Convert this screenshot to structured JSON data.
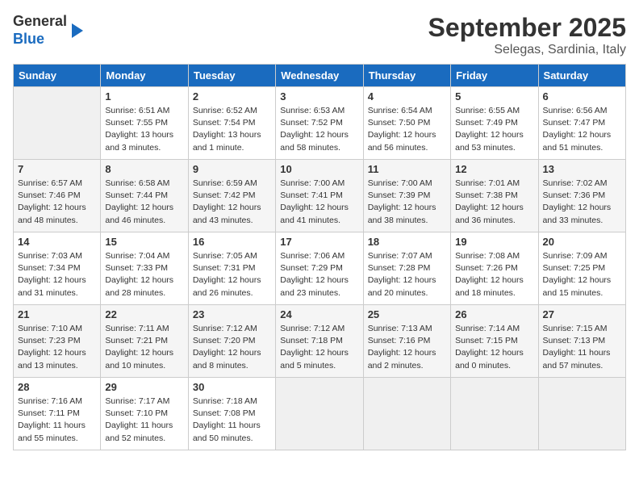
{
  "header": {
    "logo_line1": "General",
    "logo_line2": "Blue",
    "month": "September 2025",
    "location": "Selegas, Sardinia, Italy"
  },
  "days_of_week": [
    "Sunday",
    "Monday",
    "Tuesday",
    "Wednesday",
    "Thursday",
    "Friday",
    "Saturday"
  ],
  "weeks": [
    [
      {
        "day": "",
        "empty": true
      },
      {
        "day": "1",
        "sunrise": "Sunrise: 6:51 AM",
        "sunset": "Sunset: 7:55 PM",
        "daylight": "Daylight: 13 hours and 3 minutes."
      },
      {
        "day": "2",
        "sunrise": "Sunrise: 6:52 AM",
        "sunset": "Sunset: 7:54 PM",
        "daylight": "Daylight: 13 hours and 1 minute."
      },
      {
        "day": "3",
        "sunrise": "Sunrise: 6:53 AM",
        "sunset": "Sunset: 7:52 PM",
        "daylight": "Daylight: 12 hours and 58 minutes."
      },
      {
        "day": "4",
        "sunrise": "Sunrise: 6:54 AM",
        "sunset": "Sunset: 7:50 PM",
        "daylight": "Daylight: 12 hours and 56 minutes."
      },
      {
        "day": "5",
        "sunrise": "Sunrise: 6:55 AM",
        "sunset": "Sunset: 7:49 PM",
        "daylight": "Daylight: 12 hours and 53 minutes."
      },
      {
        "day": "6",
        "sunrise": "Sunrise: 6:56 AM",
        "sunset": "Sunset: 7:47 PM",
        "daylight": "Daylight: 12 hours and 51 minutes."
      }
    ],
    [
      {
        "day": "7",
        "sunrise": "Sunrise: 6:57 AM",
        "sunset": "Sunset: 7:46 PM",
        "daylight": "Daylight: 12 hours and 48 minutes."
      },
      {
        "day": "8",
        "sunrise": "Sunrise: 6:58 AM",
        "sunset": "Sunset: 7:44 PM",
        "daylight": "Daylight: 12 hours and 46 minutes."
      },
      {
        "day": "9",
        "sunrise": "Sunrise: 6:59 AM",
        "sunset": "Sunset: 7:42 PM",
        "daylight": "Daylight: 12 hours and 43 minutes."
      },
      {
        "day": "10",
        "sunrise": "Sunrise: 7:00 AM",
        "sunset": "Sunset: 7:41 PM",
        "daylight": "Daylight: 12 hours and 41 minutes."
      },
      {
        "day": "11",
        "sunrise": "Sunrise: 7:00 AM",
        "sunset": "Sunset: 7:39 PM",
        "daylight": "Daylight: 12 hours and 38 minutes."
      },
      {
        "day": "12",
        "sunrise": "Sunrise: 7:01 AM",
        "sunset": "Sunset: 7:38 PM",
        "daylight": "Daylight: 12 hours and 36 minutes."
      },
      {
        "day": "13",
        "sunrise": "Sunrise: 7:02 AM",
        "sunset": "Sunset: 7:36 PM",
        "daylight": "Daylight: 12 hours and 33 minutes."
      }
    ],
    [
      {
        "day": "14",
        "sunrise": "Sunrise: 7:03 AM",
        "sunset": "Sunset: 7:34 PM",
        "daylight": "Daylight: 12 hours and 31 minutes."
      },
      {
        "day": "15",
        "sunrise": "Sunrise: 7:04 AM",
        "sunset": "Sunset: 7:33 PM",
        "daylight": "Daylight: 12 hours and 28 minutes."
      },
      {
        "day": "16",
        "sunrise": "Sunrise: 7:05 AM",
        "sunset": "Sunset: 7:31 PM",
        "daylight": "Daylight: 12 hours and 26 minutes."
      },
      {
        "day": "17",
        "sunrise": "Sunrise: 7:06 AM",
        "sunset": "Sunset: 7:29 PM",
        "daylight": "Daylight: 12 hours and 23 minutes."
      },
      {
        "day": "18",
        "sunrise": "Sunrise: 7:07 AM",
        "sunset": "Sunset: 7:28 PM",
        "daylight": "Daylight: 12 hours and 20 minutes."
      },
      {
        "day": "19",
        "sunrise": "Sunrise: 7:08 AM",
        "sunset": "Sunset: 7:26 PM",
        "daylight": "Daylight: 12 hours and 18 minutes."
      },
      {
        "day": "20",
        "sunrise": "Sunrise: 7:09 AM",
        "sunset": "Sunset: 7:25 PM",
        "daylight": "Daylight: 12 hours and 15 minutes."
      }
    ],
    [
      {
        "day": "21",
        "sunrise": "Sunrise: 7:10 AM",
        "sunset": "Sunset: 7:23 PM",
        "daylight": "Daylight: 12 hours and 13 minutes."
      },
      {
        "day": "22",
        "sunrise": "Sunrise: 7:11 AM",
        "sunset": "Sunset: 7:21 PM",
        "daylight": "Daylight: 12 hours and 10 minutes."
      },
      {
        "day": "23",
        "sunrise": "Sunrise: 7:12 AM",
        "sunset": "Sunset: 7:20 PM",
        "daylight": "Daylight: 12 hours and 8 minutes."
      },
      {
        "day": "24",
        "sunrise": "Sunrise: 7:12 AM",
        "sunset": "Sunset: 7:18 PM",
        "daylight": "Daylight: 12 hours and 5 minutes."
      },
      {
        "day": "25",
        "sunrise": "Sunrise: 7:13 AM",
        "sunset": "Sunset: 7:16 PM",
        "daylight": "Daylight: 12 hours and 2 minutes."
      },
      {
        "day": "26",
        "sunrise": "Sunrise: 7:14 AM",
        "sunset": "Sunset: 7:15 PM",
        "daylight": "Daylight: 12 hours and 0 minutes."
      },
      {
        "day": "27",
        "sunrise": "Sunrise: 7:15 AM",
        "sunset": "Sunset: 7:13 PM",
        "daylight": "Daylight: 11 hours and 57 minutes."
      }
    ],
    [
      {
        "day": "28",
        "sunrise": "Sunrise: 7:16 AM",
        "sunset": "Sunset: 7:11 PM",
        "daylight": "Daylight: 11 hours and 55 minutes."
      },
      {
        "day": "29",
        "sunrise": "Sunrise: 7:17 AM",
        "sunset": "Sunset: 7:10 PM",
        "daylight": "Daylight: 11 hours and 52 minutes."
      },
      {
        "day": "30",
        "sunrise": "Sunrise: 7:18 AM",
        "sunset": "Sunset: 7:08 PM",
        "daylight": "Daylight: 11 hours and 50 minutes."
      },
      {
        "day": "",
        "empty": true
      },
      {
        "day": "",
        "empty": true
      },
      {
        "day": "",
        "empty": true
      },
      {
        "day": "",
        "empty": true
      }
    ]
  ]
}
